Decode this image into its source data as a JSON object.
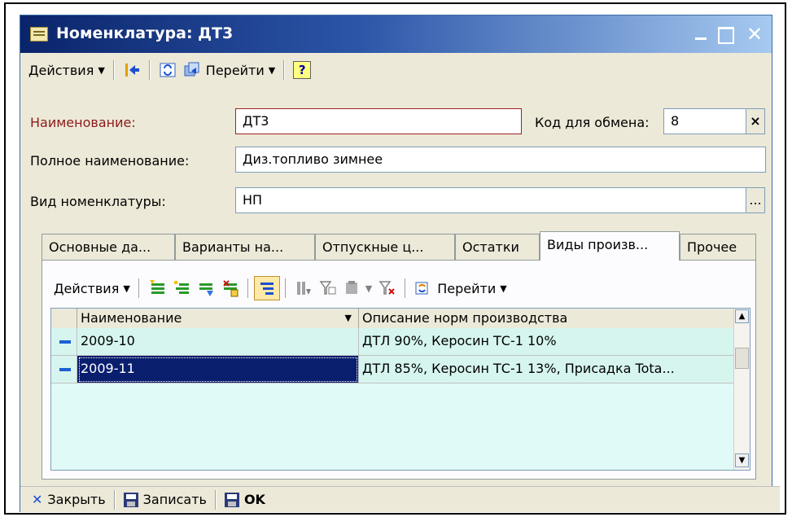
{
  "window": {
    "title": "Номенклатура: ДТ3"
  },
  "toolbar": {
    "actions_label": "Действия",
    "goto_label": "Перейти",
    "help_label": "?"
  },
  "form": {
    "name_label": "Наименование:",
    "name_value": "ДТ3",
    "exchange_code_label": "Код для обмена:",
    "exchange_code_value": "8",
    "clear_symbol": "×",
    "full_name_label": "Полное наименование:",
    "full_name_value": "Диз.топливо зимнее",
    "type_label": "Вид номенклатуры:",
    "type_value": "НП",
    "select_symbol": "..."
  },
  "tabs": [
    {
      "label": "Основные да..."
    },
    {
      "label": "Варианты на..."
    },
    {
      "label": "Отпускные ц..."
    },
    {
      "label": "Остатки"
    },
    {
      "label": "Виды произв..."
    },
    {
      "label": "Прочее"
    }
  ],
  "active_tab_index": 4,
  "inner_toolbar": {
    "actions_label": "Действия",
    "goto_label": "Перейти"
  },
  "table": {
    "columns": [
      "Наименование",
      "Описание норм производства"
    ],
    "rows": [
      {
        "name": "2009-10",
        "description": "ДТЛ 90%, Керосин ТС-1 10%"
      },
      {
        "name": "2009-11",
        "description": "ДТЛ 85%, Керосин ТС-1 13%, Присадка Tota..."
      }
    ],
    "selected_row": 1
  },
  "bottom": {
    "close_label": "Закрыть",
    "save_label": "Записать",
    "ok_label": "OK"
  },
  "colors": {
    "titlebar_start": "#0a246a",
    "row_bg": "#d6f5ef",
    "selected_bg": "#0a1e6e",
    "label_red": "#8b1a1a"
  }
}
